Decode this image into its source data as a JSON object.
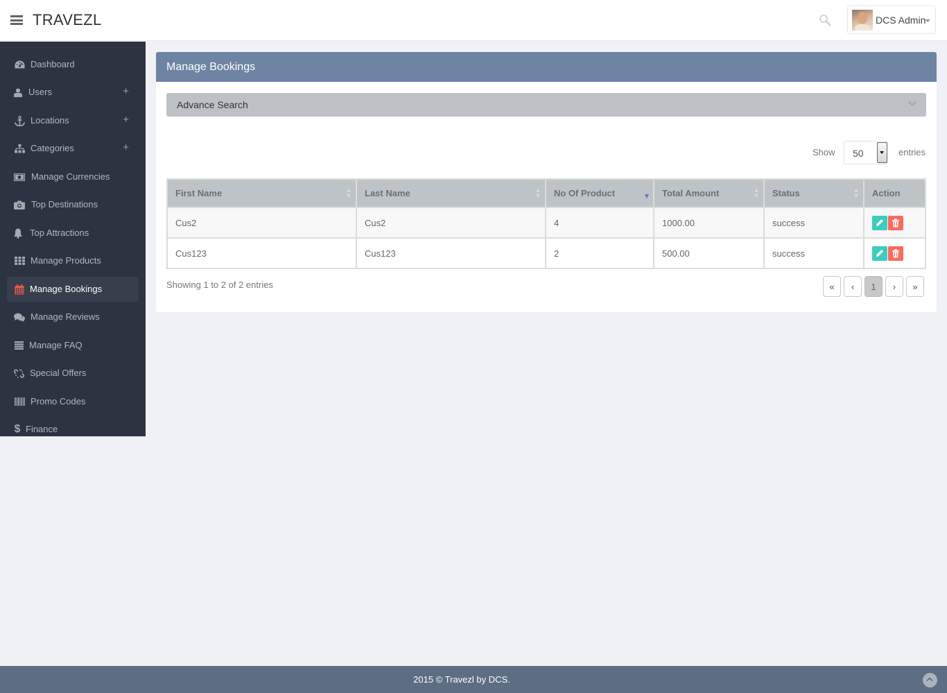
{
  "app": {
    "brand": "TRAVEZL"
  },
  "header": {
    "user_name": "DCS Admin",
    "icons": [
      "menu-icon",
      "search-icon",
      "caret-down-icon"
    ]
  },
  "sidebar": {
    "items": [
      {
        "label": "Dashboard",
        "icon": "dashboard-icon",
        "expandable": false,
        "active": false
      },
      {
        "label": "Users",
        "icon": "user-icon",
        "expandable": true,
        "active": false
      },
      {
        "label": "Locations",
        "icon": "anchor-icon",
        "expandable": true,
        "active": false
      },
      {
        "label": "Categories",
        "icon": "sitemap-icon",
        "expandable": true,
        "active": false
      },
      {
        "label": "Manage Currencies",
        "icon": "money-icon",
        "expandable": false,
        "active": false
      },
      {
        "label": "Top Destinations",
        "icon": "camera-icon",
        "expandable": false,
        "active": false
      },
      {
        "label": "Top Attractions",
        "icon": "bell-icon",
        "expandable": false,
        "active": false
      },
      {
        "label": "Manage Products",
        "icon": "grid-icon",
        "expandable": false,
        "active": false
      },
      {
        "label": "Manage Bookings",
        "icon": "calendar-icon",
        "expandable": false,
        "active": true
      },
      {
        "label": "Manage Reviews",
        "icon": "comments-icon",
        "expandable": false,
        "active": false
      },
      {
        "label": "Manage FAQ",
        "icon": "list-icon",
        "expandable": false,
        "active": false
      },
      {
        "label": "Special Offers",
        "icon": "unlink-icon",
        "expandable": false,
        "active": false
      },
      {
        "label": "Promo Codes",
        "icon": "barcode-icon",
        "expandable": false,
        "active": false
      },
      {
        "label": "Finance",
        "icon": "dollar-icon",
        "expandable": false,
        "active": false
      }
    ],
    "plus_symbol": "+"
  },
  "main": {
    "title": "Manage Bookings",
    "advance_search_label": "Advance Search",
    "length_control": {
      "show_label": "Show",
      "value": "50",
      "entries_label": "entries"
    },
    "table": {
      "columns": [
        {
          "label": "First Name",
          "sort": "both"
        },
        {
          "label": "Last Name",
          "sort": "both"
        },
        {
          "label": "No Of Product",
          "sort": "desc"
        },
        {
          "label": "Total Amount",
          "sort": "both"
        },
        {
          "label": "Status",
          "sort": "both"
        },
        {
          "label": "Action",
          "sort": "none"
        }
      ],
      "rows": [
        {
          "first_name": "Cus2",
          "last_name": "Cus2",
          "no_of_product": "4",
          "total_amount": "1000.00",
          "status": "success"
        },
        {
          "first_name": "Cus123",
          "last_name": "Cus123",
          "no_of_product": "2",
          "total_amount": "500.00",
          "status": "success"
        }
      ],
      "action_icons": [
        "pencil-icon",
        "trash-icon"
      ]
    },
    "info_text": "Showing 1 to 2 of 2 entries",
    "pagination": {
      "first": "«",
      "prev": "‹",
      "current": "1",
      "next": "›",
      "last": "»"
    }
  },
  "footer": {
    "text": "2015 © Travezl by DCS."
  },
  "colors": {
    "sidebar_bg": "#2b3440",
    "panel_header": "#6e84a3",
    "edit_button": "#3fcbbd",
    "delete_button": "#f96b5d",
    "active_icon": "#e9594f",
    "footer_bg": "#5d6d82"
  }
}
